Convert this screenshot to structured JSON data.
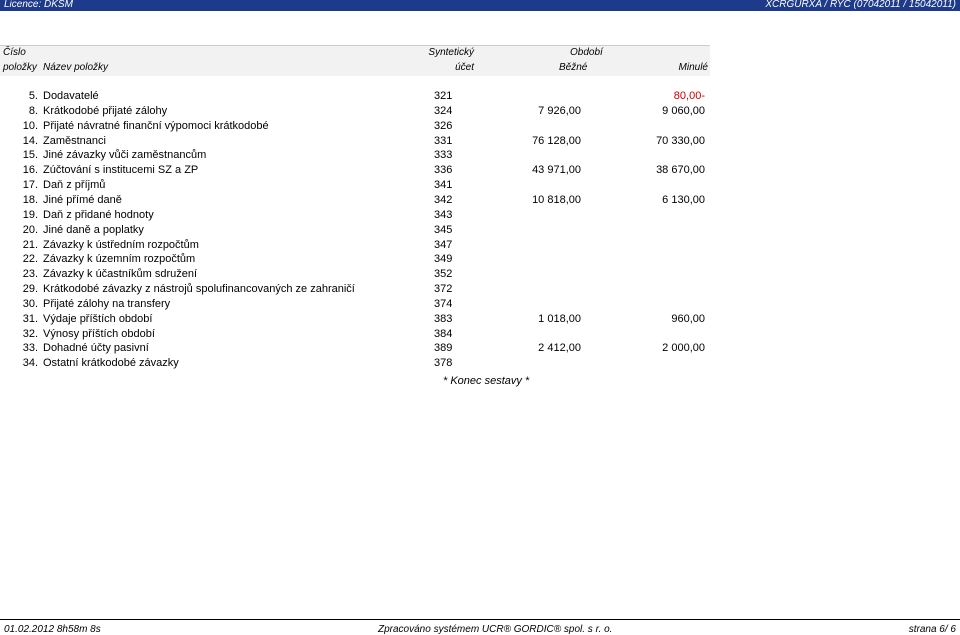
{
  "top_bar": {
    "licence": "Licence: DKSM",
    "report_code": "XCRGURXA / RYC  (07042011 / 15042011)"
  },
  "header": {
    "cislo": "Číslo",
    "polozky": "položky",
    "nazev": "Název položky",
    "synteticky": "Syntetický",
    "ucet": "účet",
    "obdobi": "Období",
    "bezne": "Běžné",
    "minule": "Minulé"
  },
  "rows": [
    {
      "num": "5.",
      "name": "Dodavatelé",
      "account": "321",
      "current": "",
      "previous": "80,00-",
      "previous_negative": true
    },
    {
      "num": "8.",
      "name": "Krátkodobé přijaté zálohy",
      "account": "324",
      "current": "7 926,00",
      "previous": "9 060,00"
    },
    {
      "num": "10.",
      "name": "Přijaté návratné finanční výpomoci krátkodobé",
      "account": "326",
      "current": "",
      "previous": ""
    },
    {
      "num": "14.",
      "name": "Zaměstnanci",
      "account": "331",
      "current": "76 128,00",
      "previous": "70 330,00"
    },
    {
      "num": "15.",
      "name": "Jiné závazky vůči zaměstnancům",
      "account": "333",
      "current": "",
      "previous": ""
    },
    {
      "num": "16.",
      "name": "Zúčtování s institucemi SZ a ZP",
      "account": "336",
      "current": "43 971,00",
      "previous": "38 670,00"
    },
    {
      "num": "17.",
      "name": "Daň z příjmů",
      "account": "341",
      "current": "",
      "previous": ""
    },
    {
      "num": "18.",
      "name": "Jiné přímé daně",
      "account": "342",
      "current": "10 818,00",
      "previous": "6 130,00"
    },
    {
      "num": "19.",
      "name": "Daň z přidané hodnoty",
      "account": "343",
      "current": "",
      "previous": ""
    },
    {
      "num": "20.",
      "name": "Jiné daně a poplatky",
      "account": "345",
      "current": "",
      "previous": ""
    },
    {
      "num": "21.",
      "name": "Závazky k ústředním rozpočtům",
      "account": "347",
      "current": "",
      "previous": ""
    },
    {
      "num": "22.",
      "name": "Závazky k územním rozpočtům",
      "account": "349",
      "current": "",
      "previous": ""
    },
    {
      "num": "23.",
      "name": "Závazky k účastníkům sdružení",
      "account": "352",
      "current": "",
      "previous": ""
    },
    {
      "num": "29.",
      "name": "Krátkodobé závazky z nástrojů spolufinancovaných ze zahraničí",
      "account": "372",
      "current": "",
      "previous": ""
    },
    {
      "num": "30.",
      "name": "Přijaté zálohy na transfery",
      "account": "374",
      "current": "",
      "previous": ""
    },
    {
      "num": "31.",
      "name": "Výdaje příštích období",
      "account": "383",
      "current": "1 018,00",
      "previous": "960,00"
    },
    {
      "num": "32.",
      "name": "Výnosy příštích období",
      "account": "384",
      "current": "",
      "previous": ""
    },
    {
      "num": "33.",
      "name": "Dohadné účty pasivní",
      "account": "389",
      "current": "2 412,00",
      "previous": "2 000,00"
    },
    {
      "num": "34.",
      "name": "Ostatní krátkodobé závazky",
      "account": "378",
      "current": "",
      "previous": ""
    }
  ],
  "end_note": "* Konec sestavy *",
  "footer": {
    "datetime": "01.02.2012 8h58m 8s",
    "processed_by": "Zpracováno systémem  UCR® GORDIC® spol. s  r. o.",
    "page": "strana  6/ 6"
  },
  "colors": {
    "top_bar": "#1e3a8a",
    "header_bg": "#f2f2f2",
    "negative": "#cc0000"
  }
}
